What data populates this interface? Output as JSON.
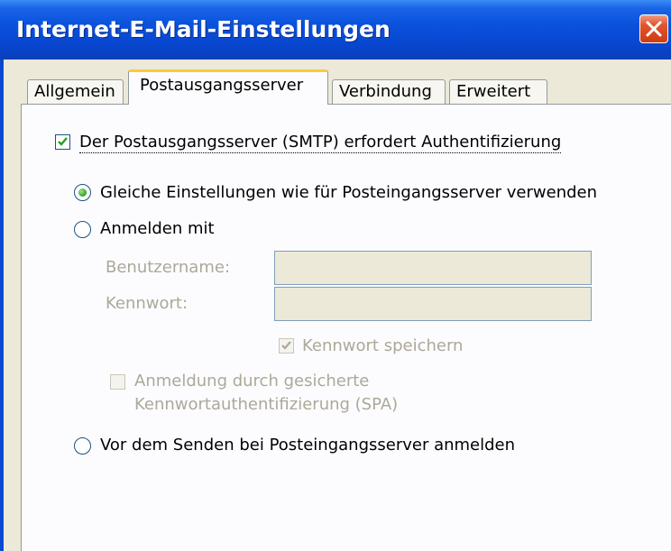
{
  "window": {
    "title": "Internet-E-Mail-Einstellungen"
  },
  "tabs": [
    {
      "label": "Allgemein",
      "active": false
    },
    {
      "label": "Postausgangsserver",
      "active": true
    },
    {
      "label": "Verbindung",
      "active": false
    },
    {
      "label": "Erweitert",
      "active": false
    }
  ],
  "smtp_auth": {
    "label": "Der Postausgangsserver (SMTP) erfordert Authentifizierung",
    "checked": true
  },
  "options": {
    "same_settings": {
      "label": "Gleiche Einstellungen wie für Posteingangsserver verwenden",
      "selected": true
    },
    "login_with": {
      "label": "Anmelden mit",
      "selected": false
    },
    "login_before_send": {
      "label": "Vor dem Senden bei Posteingangsserver anmelden",
      "selected": false
    }
  },
  "credentials": {
    "username_label": "Benutzername:",
    "username_value": "",
    "password_label": "Kennwort:",
    "password_value": "",
    "remember_password": {
      "label": "Kennwort speichern",
      "checked": true,
      "enabled": false
    },
    "spa": {
      "label_line1": "Anmeldung durch gesicherte",
      "label_line2": "Kennwortauthentifizierung (SPA)",
      "checked": false,
      "enabled": false
    }
  },
  "icons": {
    "close": "close-icon",
    "checkmark": "checkmark-icon"
  },
  "colors": {
    "titlebar": "#0a52dd",
    "active_tab_highlight": "#ffc83c",
    "checkmark": "#21a121",
    "close_button": "#e3552e"
  }
}
